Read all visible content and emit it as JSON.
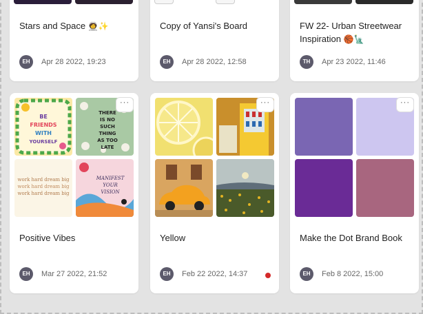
{
  "boards_top": [
    {
      "title": "Stars and Space",
      "emoji": "🧑‍🚀✨",
      "initials": "EH",
      "date": "Apr 28 2022, 19:23"
    },
    {
      "title": "Copy of Yansi's Board",
      "emoji": "",
      "initials": "EH",
      "date": "Apr 28 2022, 12:58"
    },
    {
      "title": "FW 22- Urban Streetwear Inspiration",
      "emoji": "🏀🗽",
      "initials": "TH",
      "date": "Apr 23 2022, 11:46"
    }
  ],
  "boards_bottom": [
    {
      "title": "Positive Vibes",
      "initials": "EH",
      "date": "Mar 27 2022, 21:52"
    },
    {
      "title": "Yellow",
      "initials": "EH",
      "date": "Feb 22 2022, 14:37"
    },
    {
      "title": "Make the Dot Brand Book",
      "initials": "EH",
      "date": "Feb 8 2022, 15:00"
    }
  ],
  "more_label": "···",
  "positive_vibes_tiles": {
    "tl": "BE FRIENDS WITH YOURSELF",
    "tr": "THERE IS NO SUCH THING AS TOO LATE",
    "bl": "work hard dream big",
    "br": "MANIFEST YOUR VISION"
  },
  "brand_colors": [
    "#7a66b3",
    "#cdc6f0",
    "#6a2b96",
    "#a8667f"
  ],
  "colors": {
    "avatar": "#5c5a6b",
    "notification": "#d42a2a"
  }
}
